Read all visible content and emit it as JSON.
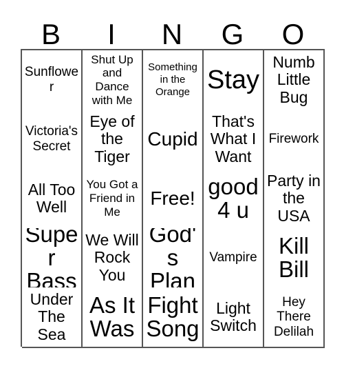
{
  "card": {
    "title": "BINGO",
    "header_letters": [
      "B",
      "I",
      "N",
      "G",
      "O"
    ],
    "colors": {
      "border": "#555555",
      "background": "#ffffff",
      "text": "#000000"
    },
    "grid": {
      "columns": 5,
      "rows": 5,
      "free_space_label": "Free!",
      "free_space_position": "center"
    },
    "rows": [
      [
        {
          "label": "Sunflower",
          "size": "sz-m"
        },
        {
          "label": "Shut Up and Dance with Me",
          "size": "sz-s"
        },
        {
          "label": "Something in the Orange",
          "size": "sz-xs"
        },
        {
          "label": "Stay",
          "size": "sz-huge"
        },
        {
          "label": "Numb Little Bug",
          "size": "sz-l"
        }
      ],
      [
        {
          "label": "Victoria's Secret",
          "size": "sz-m"
        },
        {
          "label": "Eye of the Tiger",
          "size": "sz-l"
        },
        {
          "label": "Cupid",
          "size": "sz-xl"
        },
        {
          "label": "That's What I Want",
          "size": "sz-l"
        },
        {
          "label": "Firework",
          "size": "sz-m"
        }
      ],
      [
        {
          "label": "All Too Well",
          "size": "sz-l"
        },
        {
          "label": "You Got a Friend in Me",
          "size": "sz-s"
        },
        {
          "label": "Free!",
          "size": "sz-xl"
        },
        {
          "label": "good 4 u",
          "size": "sz-xxl"
        },
        {
          "label": "Party in the USA",
          "size": "sz-l"
        }
      ],
      [
        {
          "label": "Super Bass",
          "size": "sz-xxl"
        },
        {
          "label": "We Will Rock You",
          "size": "sz-l"
        },
        {
          "label": "God's Plan",
          "size": "sz-xxl"
        },
        {
          "label": "Vampire",
          "size": "sz-m"
        },
        {
          "label": "Kill Bill",
          "size": "sz-xxl"
        }
      ],
      [
        {
          "label": "Under The Sea",
          "size": "sz-l"
        },
        {
          "label": "As It Was",
          "size": "sz-xxl"
        },
        {
          "label": "Fight Song",
          "size": "sz-xxl"
        },
        {
          "label": "Light Switch",
          "size": "sz-l"
        },
        {
          "label": "Hey There Delilah",
          "size": "sz-m"
        }
      ]
    ]
  }
}
